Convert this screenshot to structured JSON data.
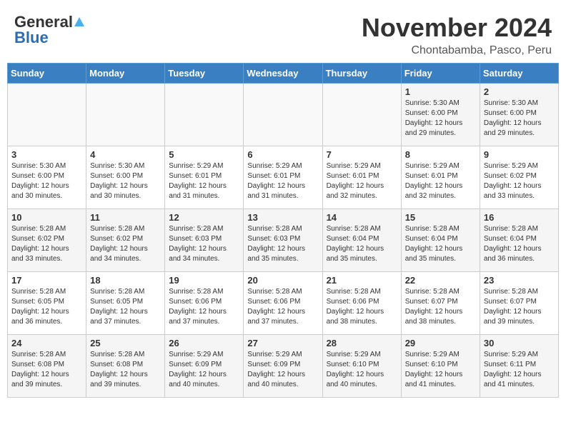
{
  "header": {
    "logo_general": "General",
    "logo_blue": "Blue",
    "month_title": "November 2024",
    "subtitle": "Chontabamba, Pasco, Peru"
  },
  "weekdays": [
    "Sunday",
    "Monday",
    "Tuesday",
    "Wednesday",
    "Thursday",
    "Friday",
    "Saturday"
  ],
  "weeks": [
    [
      {
        "day": "",
        "content": ""
      },
      {
        "day": "",
        "content": ""
      },
      {
        "day": "",
        "content": ""
      },
      {
        "day": "",
        "content": ""
      },
      {
        "day": "",
        "content": ""
      },
      {
        "day": "1",
        "content": "Sunrise: 5:30 AM\nSunset: 6:00 PM\nDaylight: 12 hours and 29 minutes."
      },
      {
        "day": "2",
        "content": "Sunrise: 5:30 AM\nSunset: 6:00 PM\nDaylight: 12 hours and 29 minutes."
      }
    ],
    [
      {
        "day": "3",
        "content": "Sunrise: 5:30 AM\nSunset: 6:00 PM\nDaylight: 12 hours and 30 minutes."
      },
      {
        "day": "4",
        "content": "Sunrise: 5:30 AM\nSunset: 6:00 PM\nDaylight: 12 hours and 30 minutes."
      },
      {
        "day": "5",
        "content": "Sunrise: 5:29 AM\nSunset: 6:01 PM\nDaylight: 12 hours and 31 minutes."
      },
      {
        "day": "6",
        "content": "Sunrise: 5:29 AM\nSunset: 6:01 PM\nDaylight: 12 hours and 31 minutes."
      },
      {
        "day": "7",
        "content": "Sunrise: 5:29 AM\nSunset: 6:01 PM\nDaylight: 12 hours and 32 minutes."
      },
      {
        "day": "8",
        "content": "Sunrise: 5:29 AM\nSunset: 6:01 PM\nDaylight: 12 hours and 32 minutes."
      },
      {
        "day": "9",
        "content": "Sunrise: 5:29 AM\nSunset: 6:02 PM\nDaylight: 12 hours and 33 minutes."
      }
    ],
    [
      {
        "day": "10",
        "content": "Sunrise: 5:28 AM\nSunset: 6:02 PM\nDaylight: 12 hours and 33 minutes."
      },
      {
        "day": "11",
        "content": "Sunrise: 5:28 AM\nSunset: 6:02 PM\nDaylight: 12 hours and 34 minutes."
      },
      {
        "day": "12",
        "content": "Sunrise: 5:28 AM\nSunset: 6:03 PM\nDaylight: 12 hours and 34 minutes."
      },
      {
        "day": "13",
        "content": "Sunrise: 5:28 AM\nSunset: 6:03 PM\nDaylight: 12 hours and 35 minutes."
      },
      {
        "day": "14",
        "content": "Sunrise: 5:28 AM\nSunset: 6:04 PM\nDaylight: 12 hours and 35 minutes."
      },
      {
        "day": "15",
        "content": "Sunrise: 5:28 AM\nSunset: 6:04 PM\nDaylight: 12 hours and 35 minutes."
      },
      {
        "day": "16",
        "content": "Sunrise: 5:28 AM\nSunset: 6:04 PM\nDaylight: 12 hours and 36 minutes."
      }
    ],
    [
      {
        "day": "17",
        "content": "Sunrise: 5:28 AM\nSunset: 6:05 PM\nDaylight: 12 hours and 36 minutes."
      },
      {
        "day": "18",
        "content": "Sunrise: 5:28 AM\nSunset: 6:05 PM\nDaylight: 12 hours and 37 minutes."
      },
      {
        "day": "19",
        "content": "Sunrise: 5:28 AM\nSunset: 6:06 PM\nDaylight: 12 hours and 37 minutes."
      },
      {
        "day": "20",
        "content": "Sunrise: 5:28 AM\nSunset: 6:06 PM\nDaylight: 12 hours and 37 minutes."
      },
      {
        "day": "21",
        "content": "Sunrise: 5:28 AM\nSunset: 6:06 PM\nDaylight: 12 hours and 38 minutes."
      },
      {
        "day": "22",
        "content": "Sunrise: 5:28 AM\nSunset: 6:07 PM\nDaylight: 12 hours and 38 minutes."
      },
      {
        "day": "23",
        "content": "Sunrise: 5:28 AM\nSunset: 6:07 PM\nDaylight: 12 hours and 39 minutes."
      }
    ],
    [
      {
        "day": "24",
        "content": "Sunrise: 5:28 AM\nSunset: 6:08 PM\nDaylight: 12 hours and 39 minutes."
      },
      {
        "day": "25",
        "content": "Sunrise: 5:28 AM\nSunset: 6:08 PM\nDaylight: 12 hours and 39 minutes."
      },
      {
        "day": "26",
        "content": "Sunrise: 5:29 AM\nSunset: 6:09 PM\nDaylight: 12 hours and 40 minutes."
      },
      {
        "day": "27",
        "content": "Sunrise: 5:29 AM\nSunset: 6:09 PM\nDaylight: 12 hours and 40 minutes."
      },
      {
        "day": "28",
        "content": "Sunrise: 5:29 AM\nSunset: 6:10 PM\nDaylight: 12 hours and 40 minutes."
      },
      {
        "day": "29",
        "content": "Sunrise: 5:29 AM\nSunset: 6:10 PM\nDaylight: 12 hours and 41 minutes."
      },
      {
        "day": "30",
        "content": "Sunrise: 5:29 AM\nSunset: 6:11 PM\nDaylight: 12 hours and 41 minutes."
      }
    ]
  ]
}
